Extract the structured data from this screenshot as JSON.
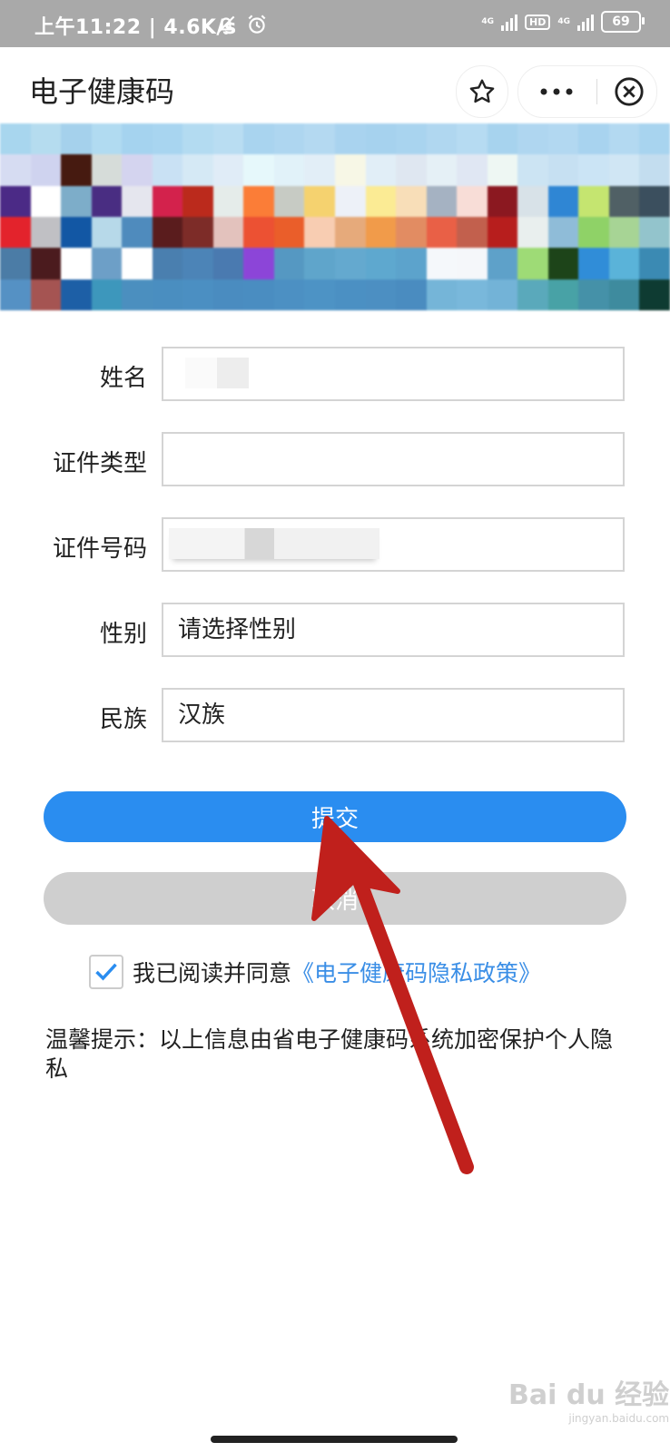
{
  "status_bar": {
    "time": "上午11:22",
    "speed": "4.6K/s",
    "network_1": "4G",
    "hd": "HD",
    "network_2": "4G",
    "battery": "69"
  },
  "header": {
    "title": "电子健康码",
    "icons": [
      "star-icon",
      "more-icon",
      "close-icon"
    ]
  },
  "banner": {
    "colors": [
      "#a8d6ee",
      "#b5dcef",
      "#a5d1ec",
      "#b1dbf1",
      "#a5d3ef",
      "#a8d5f0",
      "#b3dbf1",
      "#b9ddf2",
      "#a9d4ef",
      "#aed6f0",
      "#b4d9f1",
      "#a9d3ef",
      "#a6d2ee",
      "#a9d4ef",
      "#b0d7f0",
      "#b6dbf2",
      "#a7d3ee",
      "#afd6f0",
      "#b2d8f1",
      "#a8d3ef",
      "#b3d9f1",
      "#a8d4ef",
      "#d6dcf2",
      "#cfd3ef",
      "#461a10",
      "#d6dcd9",
      "#d4d4ef",
      "#c9e1f4",
      "#d5e9f5",
      "#e0ecf7",
      "#e6f8fb",
      "#e1f2f9",
      "#e2eef7",
      "#f7f7e6",
      "#e1eef7",
      "#dfe7f1",
      "#e5f0f6",
      "#e0e7f3",
      "#eef7f3",
      "#cce4f3",
      "#c6e0f2",
      "#cbe4f5",
      "#d0e6f4",
      "#c3ddef",
      "#4b2a86",
      "#ffffff",
      "#7dadc9",
      "#492d82",
      "#e5e6ee",
      "#d3224c",
      "#bb2a1c",
      "#e5ecea",
      "#fb7d37",
      "#c7cbc4",
      "#f5d26f",
      "#edf1f8",
      "#fbeb94",
      "#f8deb8",
      "#a5b2c2",
      "#f8ddd7",
      "#8b1820",
      "#d8e2e8",
      "#2f86d4",
      "#c5e570",
      "#506065",
      "#3b4f5e",
      "#e3232c",
      "#c0c0c4",
      "#1257a4",
      "#b7d9e9",
      "#4f8bbd",
      "#5a1c1d",
      "#7d2c28",
      "#e3c2bd",
      "#ec5133",
      "#ea5e2a",
      "#f8cdb2",
      "#e6aa7b",
      "#f19b4a",
      "#e28c62",
      "#e96046",
      "#c2604d",
      "#b71e1d",
      "#e9efee",
      "#8fbcd8",
      "#8fd267",
      "#a7d495",
      "#93c4cc",
      "#4b7ca6",
      "#4b1b1e",
      "#ffffff",
      "#6d9fc7",
      "#ffffff",
      "#4a7faf",
      "#4c84b7",
      "#4a7ab0",
      "#8c45d8",
      "#5598c2",
      "#5fa5cb",
      "#64a9cf",
      "#5ea8cf",
      "#5ca3cc",
      "#f5f8fb",
      "#f5f7fa",
      "#5ea1c9",
      "#9edb76",
      "#1d4419",
      "#308dd8",
      "#5ab3d9",
      "#3b8ab3",
      "#5591c4",
      "#a55452",
      "#1d5fa6",
      "#3d97bc",
      "#4b8fbf",
      "#4a8ec0",
      "#4b8fc2",
      "#4a8cc0",
      "#4a8dc1",
      "#4c90c3",
      "#4d93c5",
      "#4b90c3",
      "#4c8fc2",
      "#4a8cc0",
      "#75b5d8",
      "#79b8db",
      "#73b3d7",
      "#5aa9bb",
      "#48a2a6",
      "#4591a8",
      "#3e8b9e",
      "#0e3b32"
    ]
  },
  "form": {
    "name_label": "姓名",
    "name_value": "",
    "id_type_label": "证件类型",
    "id_type_value": "",
    "id_number_label": "证件号码",
    "id_number_value": "",
    "gender_label": "性别",
    "gender_placeholder": "请选择性别",
    "ethnicity_label": "民族",
    "ethnicity_value": "汉族"
  },
  "actions": {
    "submit_label": "提交",
    "cancel_label": "取消"
  },
  "agreement": {
    "checked": true,
    "text": "我已阅读并同意",
    "link": "《电子健康码隐私政策》"
  },
  "tips": {
    "text": "温馨提示：以上信息由省电子健康码系统加密保护个人隐私"
  },
  "annotation": {
    "arrow_color": "#c0201c"
  },
  "watermark": {
    "text": "Bai du 经验",
    "sub": "jingyan.baidu.com"
  }
}
